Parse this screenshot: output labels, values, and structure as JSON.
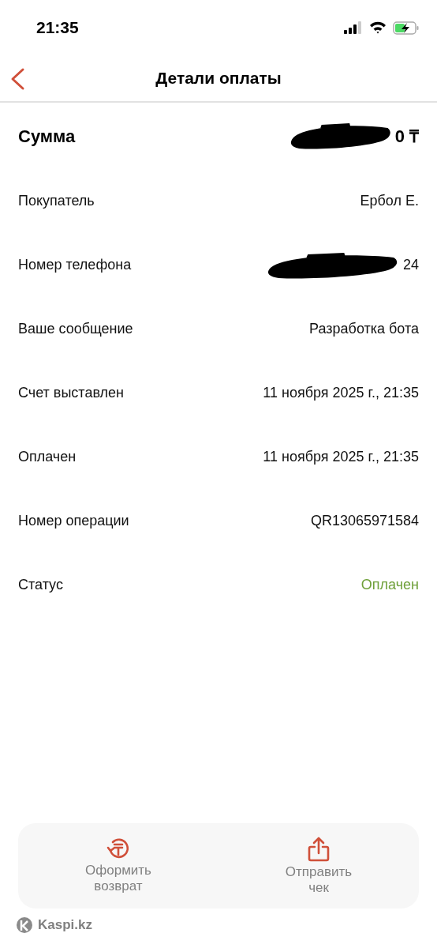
{
  "status_bar": {
    "time": "21:35"
  },
  "header": {
    "title": "Детали оплаты"
  },
  "rows": [
    {
      "kind": "amount",
      "label": "Сумма",
      "value": "0 ₸",
      "redacted": true
    },
    {
      "kind": "plain",
      "label": "Покупатель",
      "value": "Ербол Е.",
      "redacted": false
    },
    {
      "kind": "plain",
      "label": "Номер телефона",
      "value": "24",
      "redacted": true
    },
    {
      "kind": "plain",
      "label": "Ваше сообщение",
      "value": "Разработка бота",
      "redacted": false
    },
    {
      "kind": "plain",
      "label": "Счет выставлен",
      "value": "11 ноября 2025 г., 21:35",
      "redacted": false
    },
    {
      "kind": "plain",
      "label": "Оплачен",
      "value": "11 ноября 2025 г., 21:35",
      "redacted": false
    },
    {
      "kind": "plain",
      "label": "Номер операции",
      "value": "QR13065971584",
      "redacted": false
    },
    {
      "kind": "status",
      "label": "Статус",
      "value": "Оплачен",
      "redacted": false
    }
  ],
  "actions": [
    {
      "kind": "refund",
      "label": "Оформить возврат"
    },
    {
      "kind": "share",
      "label": "Отправить чек"
    }
  ],
  "footer": {
    "brand": "Kaspi.kz"
  }
}
